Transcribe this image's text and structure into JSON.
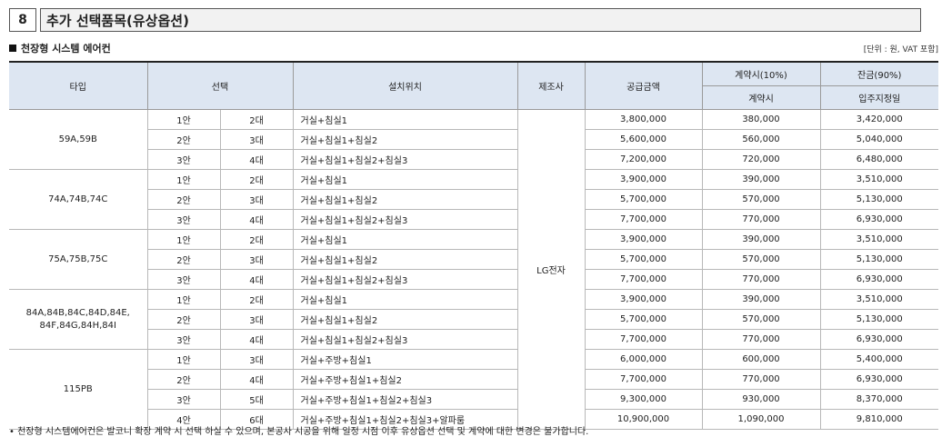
{
  "section": {
    "number": "8",
    "title": "추가 선택품목(유상옵션)"
  },
  "subheading": "천장형 시스템 에어컨",
  "unit_note": "[단위 : 원, VAT 포함]",
  "headers": {
    "type": "타입",
    "choice": "선택",
    "location": "설치위치",
    "maker": "제조사",
    "price": "공급금액",
    "contract": "계약시(10%)",
    "contract_sub": "계약시",
    "balance": "잔금(90%)",
    "balance_sub": "입주지정일"
  },
  "maker": "LG전자",
  "groups": [
    {
      "type": "59A,59B",
      "rows": [
        {
          "plan": "1안",
          "units": "2대",
          "location": "거실+침실1",
          "price": "3,800,000",
          "contract": "380,000",
          "balance": "3,420,000"
        },
        {
          "plan": "2안",
          "units": "3대",
          "location": "거실+침실1+침실2",
          "price": "5,600,000",
          "contract": "560,000",
          "balance": "5,040,000"
        },
        {
          "plan": "3안",
          "units": "4대",
          "location": "거실+침실1+침실2+침실3",
          "price": "7,200,000",
          "contract": "720,000",
          "balance": "6,480,000"
        }
      ]
    },
    {
      "type": "74A,74B,74C",
      "rows": [
        {
          "plan": "1안",
          "units": "2대",
          "location": "거실+침실1",
          "price": "3,900,000",
          "contract": "390,000",
          "balance": "3,510,000"
        },
        {
          "plan": "2안",
          "units": "3대",
          "location": "거실+침실1+침실2",
          "price": "5,700,000",
          "contract": "570,000",
          "balance": "5,130,000"
        },
        {
          "plan": "3안",
          "units": "4대",
          "location": "거실+침실1+침실2+침실3",
          "price": "7,700,000",
          "contract": "770,000",
          "balance": "6,930,000"
        }
      ]
    },
    {
      "type": "75A,75B,75C",
      "rows": [
        {
          "plan": "1안",
          "units": "2대",
          "location": "거실+침실1",
          "price": "3,900,000",
          "contract": "390,000",
          "balance": "3,510,000"
        },
        {
          "plan": "2안",
          "units": "3대",
          "location": "거실+침실1+침실2",
          "price": "5,700,000",
          "contract": "570,000",
          "balance": "5,130,000"
        },
        {
          "plan": "3안",
          "units": "4대",
          "location": "거실+침실1+침실2+침실3",
          "price": "7,700,000",
          "contract": "770,000",
          "balance": "6,930,000"
        }
      ]
    },
    {
      "type": "84A,84B,84C,84D,84E,\n84F,84G,84H,84I",
      "rows": [
        {
          "plan": "1안",
          "units": "2대",
          "location": "거실+침실1",
          "price": "3,900,000",
          "contract": "390,000",
          "balance": "3,510,000"
        },
        {
          "plan": "2안",
          "units": "3대",
          "location": "거실+침실1+침실2",
          "price": "5,700,000",
          "contract": "570,000",
          "balance": "5,130,000"
        },
        {
          "plan": "3안",
          "units": "4대",
          "location": "거실+침실1+침실2+침실3",
          "price": "7,700,000",
          "contract": "770,000",
          "balance": "6,930,000"
        }
      ]
    },
    {
      "type": "115PB",
      "rows": [
        {
          "plan": "1안",
          "units": "3대",
          "location": "거실+주방+침실1",
          "price": "6,000,000",
          "contract": "600,000",
          "balance": "5,400,000"
        },
        {
          "plan": "2안",
          "units": "4대",
          "location": "거실+주방+침실1+침실2",
          "price": "7,700,000",
          "contract": "770,000",
          "balance": "6,930,000"
        },
        {
          "plan": "3안",
          "units": "5대",
          "location": "거실+주방+침실1+침실2+침실3",
          "price": "9,300,000",
          "contract": "930,000",
          "balance": "8,370,000"
        },
        {
          "plan": "4안",
          "units": "6대",
          "location": "거실+주방+침실1+침실2+침실3+알파룸",
          "price": "10,900,000",
          "contract": "1,090,000",
          "balance": "9,810,000"
        }
      ]
    }
  ],
  "footnote": "• 천장형 시스템에어컨은 발코니 확장 계약 시 선택 하실 수 있으며, 본공사 시공을 위해 일정 시점 이후 유상옵션 선택 및 계약에 대한 변경은 불가합니다."
}
